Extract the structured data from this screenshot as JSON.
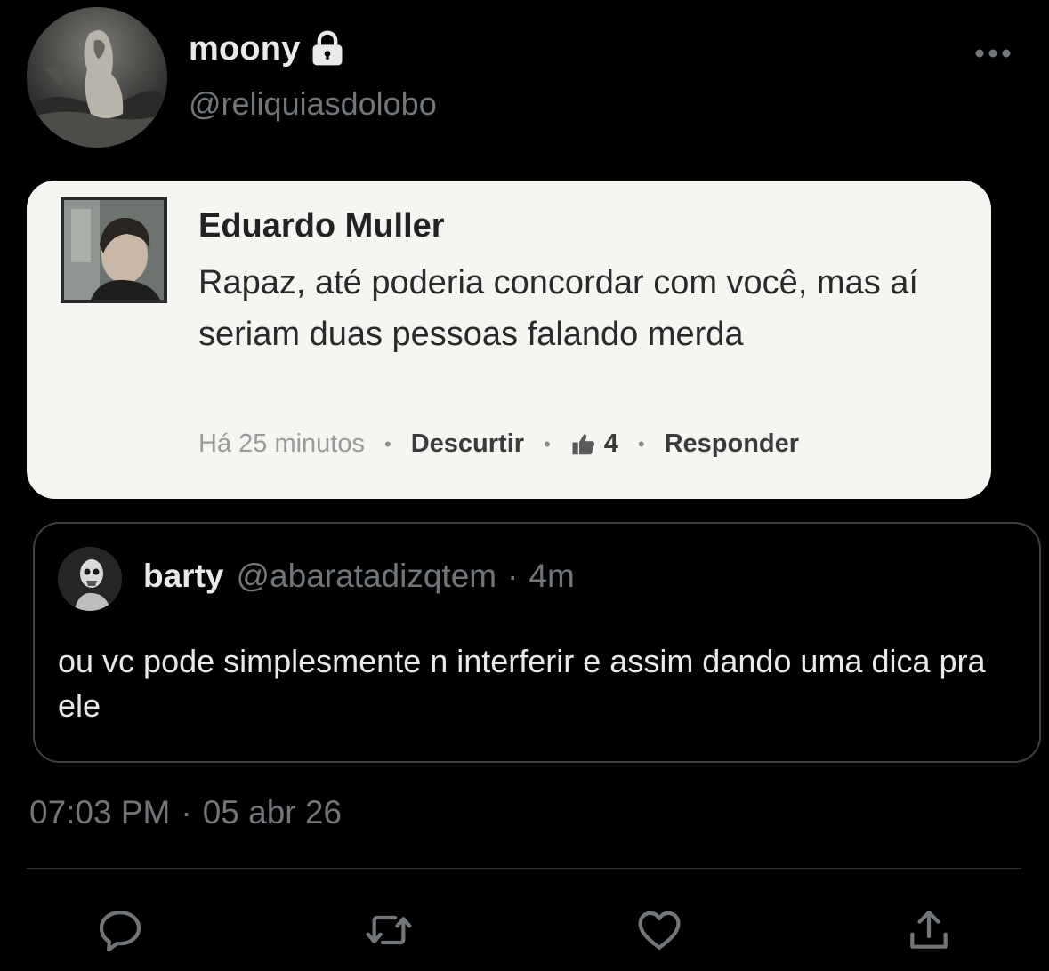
{
  "author": {
    "display_name": "moony",
    "handle": "@reliquiasdolobo",
    "protected_icon": "lock-icon"
  },
  "media": {
    "comment_author": "Eduardo Muller",
    "comment_text": "Rapaz, até poderia concordar com você, mas aí seriam duas pessoas falando merda",
    "comment_time": "Há 25 minutos",
    "comment_unlike_label": "Descurtir",
    "comment_like_count": "4",
    "comment_reply_label": "Responder",
    "separator": "•"
  },
  "quoted_tweet": {
    "display_name": "barty",
    "handle": "@abaratadizqtem",
    "separator": "·",
    "relative_time": "4m",
    "text": "ou vc pode simplesmente n interferir e assim dando uma dica pra ele"
  },
  "timestamp": {
    "time": "07:03 PM",
    "separator": "·",
    "date": "05 abr 26"
  },
  "actions": [
    "reply-icon",
    "retweet-icon",
    "like-icon",
    "share-icon"
  ],
  "colors": {
    "background": "#000000",
    "primary_text": "#e7e9ea",
    "secondary_text": "#71767b",
    "border": "#2f3336",
    "media_background": "#f4f6f2"
  }
}
